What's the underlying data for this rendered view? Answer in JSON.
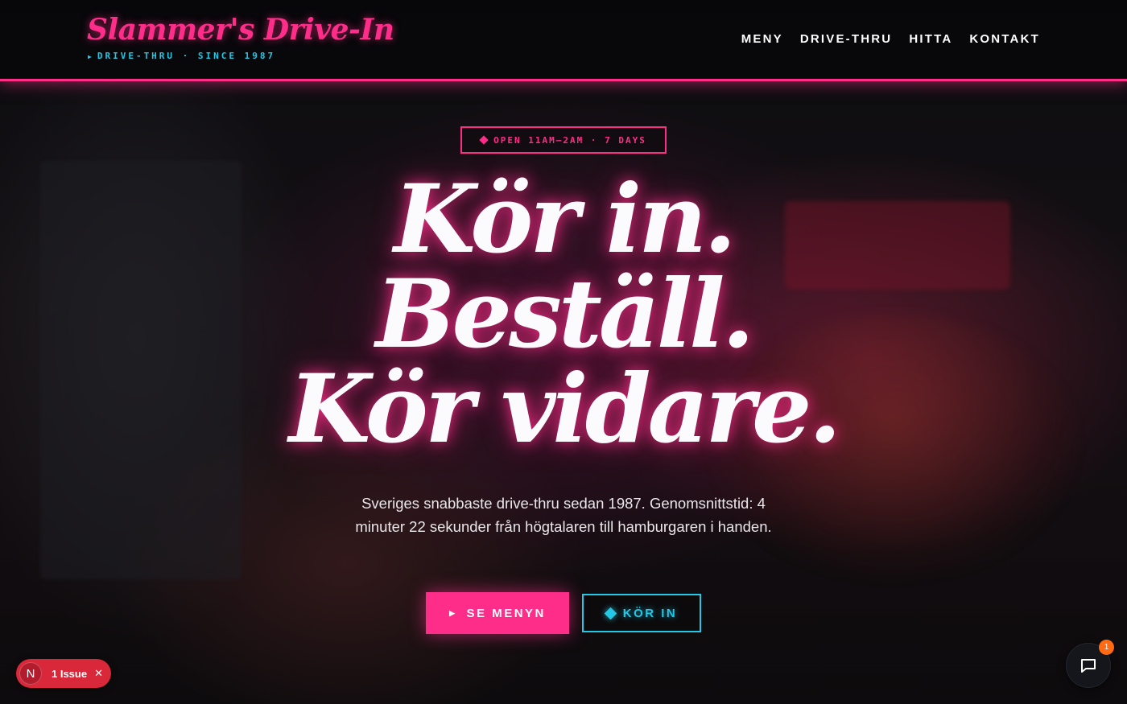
{
  "header": {
    "brand_title": "Slammer's Drive-In",
    "brand_tagline": "DRIVE-THRU · SINCE 1987",
    "nav": [
      {
        "label": "MENY"
      },
      {
        "label": "DRIVE-THRU"
      },
      {
        "label": "HITTA"
      },
      {
        "label": "KONTAKT"
      }
    ]
  },
  "hero": {
    "badge": "OPEN 11AM–2AM · 7 DAYS",
    "headline": [
      "Kör in.",
      "Beställ.",
      "Kör vidare."
    ],
    "lede": "Sveriges snabbaste drive-thru sedan 1987. Genomsnittstid: 4 minuter 22 sekunder från högtalaren till hamburgaren i handen.",
    "primary_button": "SE MENYN",
    "secondary_button": "KÖR IN"
  },
  "dev_overlay": {
    "logo_letter": "N",
    "issues_label": "1 Issue"
  },
  "chat": {
    "badge_count": "1"
  },
  "colors": {
    "accent_pink": "#ff2d8a",
    "accent_cyan": "#22c8e6",
    "background": "#0b0b0d",
    "issue_red": "#d9283a",
    "badge_orange": "#ff6a13"
  },
  "icons": [
    "play-arrow-icon",
    "diamond-icon",
    "close-icon",
    "chat-bubble-icon"
  ]
}
